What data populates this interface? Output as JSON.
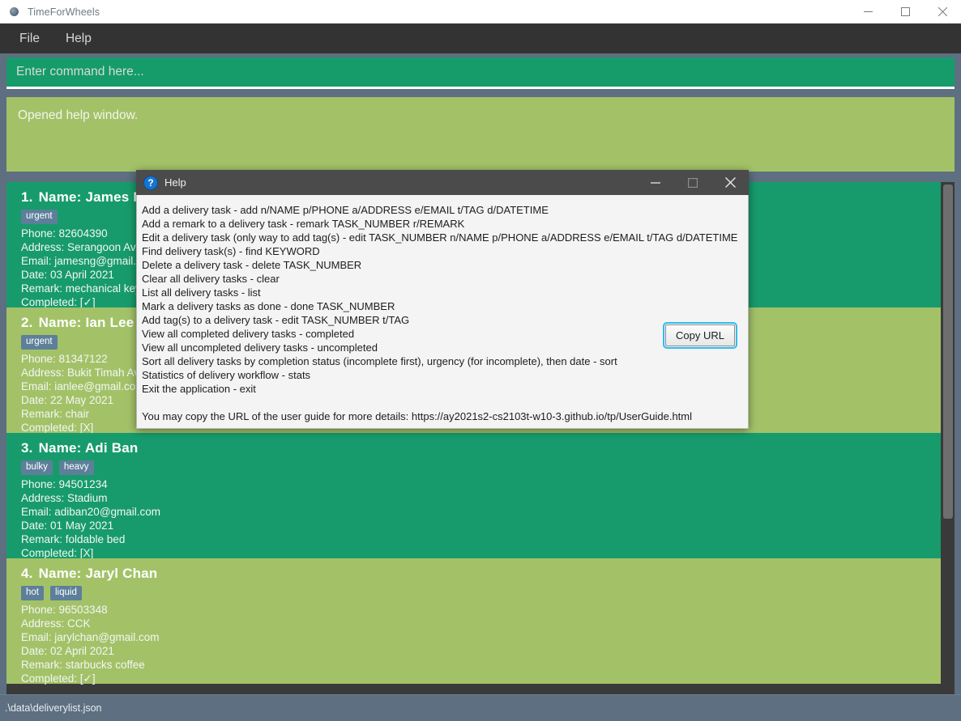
{
  "window": {
    "title": "TimeForWheels",
    "icon": "app-icon",
    "controls": {
      "minimize": "—",
      "maximize": "☐",
      "close": "✕"
    }
  },
  "menubar": {
    "items": [
      "File",
      "Help"
    ]
  },
  "command_box": {
    "placeholder": "Enter command here...",
    "value": ""
  },
  "result_display": {
    "text": "Opened help window."
  },
  "task_list": {
    "cards": [
      {
        "index": "1.",
        "name_label": "Name: James Ng",
        "tags": [
          "urgent"
        ],
        "phone": "Phone: 82604390",
        "address": "Address: Serangoon Ave ",
        "email": "Email: jamesng@gmail.co",
        "date": "Date: 03 April 2021",
        "remark": "Remark: mechanical keyb",
        "completed": "Completed: [✓]",
        "theme": "teal"
      },
      {
        "index": "2.",
        "name_label": "Name: Ian Lee",
        "tags": [
          "urgent"
        ],
        "phone": "Phone: 81347122",
        "address": "Address: Bukit Timah Ave",
        "email": "Email: ianlee@gmail.com",
        "date": "Date: 22 May 2021",
        "remark": "Remark: chair",
        "completed": "Completed: [X]",
        "theme": "olive"
      },
      {
        "index": "3.",
        "name_label": "Name: Adi Ban",
        "tags": [
          "bulky",
          "heavy"
        ],
        "phone": "Phone: 94501234",
        "address": "Address: Stadium",
        "email": "Email: adiban20@gmail.com",
        "date": "Date: 01 May 2021",
        "remark": "Remark: foldable bed",
        "completed": "Completed: [X]",
        "theme": "teal"
      },
      {
        "index": "4.",
        "name_label": "Name: Jaryl Chan",
        "tags": [
          "hot",
          "liquid"
        ],
        "phone": "Phone: 96503348",
        "address": "Address: CCK",
        "email": "Email: jarylchan@gmail.com",
        "date": "Date: 02 April 2021",
        "remark": "Remark: starbucks coffee",
        "completed": "Completed: [✓]",
        "theme": "olive"
      }
    ]
  },
  "status_bar": {
    "file_path": ".\\data\\deliverylist.json"
  },
  "help_dialog": {
    "title": "Help",
    "icon": "question-mark-icon",
    "controls": {
      "minimize": "—",
      "maximize": "☐",
      "close": "✕"
    },
    "lines": [
      "Add a delivery task - add n/NAME p/PHONE a/ADDRESS e/EMAIL t/TAG d/DATETIME",
      "Add a remark to a delivery task - remark TASK_NUMBER r/REMARK",
      "Edit a delivery task (only way to add tag(s) - edit TASK_NUMBER n/NAME p/PHONE a/ADDRESS e/EMAIL t/TAG d/DATETIME",
      "Find delivery task(s) - find KEYWORD",
      "Delete a delivery task - delete TASK_NUMBER",
      "Clear all delivery tasks - clear",
      "List all delivery tasks - list",
      "Mark a delivery tasks as done - done TASK_NUMBER",
      "Add tag(s) to a delivery task - edit TASK_NUMBER t/TAG",
      "View all completed delivery tasks - completed",
      "View all uncompleted delivery tasks - uncompleted",
      "Sort all delivery tasks by completion status (incomplete first), urgency (for incomplete), then date - sort",
      "Statistics of delivery workflow - stats",
      "Exit the application - exit"
    ],
    "url_line": "You may copy the URL of the user guide for more details: https://ay2021s2-cs2103t-w10-3.github.io/tp/UserGuide.html",
    "copy_button": "Copy URL"
  },
  "colors": {
    "teal": "#179b6c",
    "olive": "#a3c268",
    "app_background": "#5d6f80",
    "menubar": "#333333",
    "tag": "#5d7f99",
    "focus_ring": "#2fbdf1"
  }
}
